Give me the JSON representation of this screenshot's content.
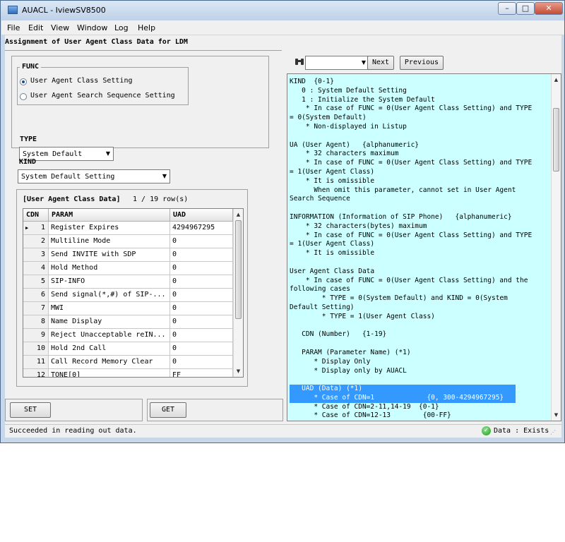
{
  "window": {
    "title": "AUACL - IviewSV8500"
  },
  "caption_buttons": {
    "minimize": "–",
    "maximize": "□",
    "close": "✕"
  },
  "menu": [
    "File",
    "Edit",
    "View",
    "Window",
    "Log",
    "Help"
  ],
  "form": {
    "title": "Assignment of User Agent Class Data for LDM",
    "func": {
      "legend": "FUNC",
      "options": [
        "User Agent Class Setting",
        "User Agent Search Sequence Setting"
      ],
      "selected": "User Agent Class Setting"
    },
    "type": {
      "label": "TYPE",
      "value": "System Default"
    },
    "kind": {
      "label": "KIND",
      "value": "System Default Setting"
    },
    "grid": {
      "title": "[User Agent Class Data]",
      "count": "1 / 19 row(s)",
      "columns": [
        "CDN",
        "PARAM",
        "UAD"
      ],
      "rows": [
        {
          "cdn": "1",
          "param": "Register Expires",
          "uad": "4294967295"
        },
        {
          "cdn": "2",
          "param": "Multiline Mode",
          "uad": "0"
        },
        {
          "cdn": "3",
          "param": "Send INVITE with SDP",
          "uad": "0"
        },
        {
          "cdn": "4",
          "param": "Hold Method",
          "uad": "0"
        },
        {
          "cdn": "5",
          "param": "SIP-INFO",
          "uad": "0"
        },
        {
          "cdn": "6",
          "param": "Send signal(*,#) of SIP-...",
          "uad": "0"
        },
        {
          "cdn": "7",
          "param": "MWI",
          "uad": "0"
        },
        {
          "cdn": "8",
          "param": "Name Display",
          "uad": "0"
        },
        {
          "cdn": "9",
          "param": "Reject Unacceptable reIN...",
          "uad": "0"
        },
        {
          "cdn": "10",
          "param": "Hold 2nd Call",
          "uad": "0"
        },
        {
          "cdn": "11",
          "param": "Call Record Memory Clear",
          "uad": "0"
        },
        {
          "cdn": "12",
          "param": "TONE[0]",
          "uad": "FF"
        }
      ]
    },
    "set_label": "SET",
    "get_label": "GET"
  },
  "search": {
    "next_label": "Next",
    "previous_label": "Previous",
    "value": ""
  },
  "help": {
    "lines": [
      "KIND  {0-1}",
      "   0 : System Default Setting",
      "   1 : Initialize the System Default",
      "    * In case of FUNC = 0(User Agent Class Setting) and TYPE",
      "= 0(System Default)",
      "    * Non-displayed in Listup",
      "",
      "UA (User Agent)   {alphanumeric}",
      "    * 32 characters maximum",
      "    * In case of FUNC = 0(User Agent Class Setting) and TYPE",
      "= 1(User Agent Class)",
      "    * It is omissible",
      "      When omit this parameter, cannot set in User Agent",
      "Search Sequence",
      "",
      "INFORMATION (Information of SIP Phone)   {alphanumeric}",
      "    * 32 characters(bytes) maximum",
      "    * In case of FUNC = 0(User Agent Class Setting) and TYPE",
      "= 1(User Agent Class)",
      "    * It is omissible",
      "",
      "User Agent Class Data",
      "    * In case of FUNC = 0(User Agent Class Setting) and the",
      "following cases",
      "        * TYPE = 0(System Default) and KIND = 0(System",
      "Default Setting)",
      "        * TYPE = 1(User Agent Class)",
      "",
      "   CDN (Number)   {1-19}",
      "",
      "   PARAM (Parameter Name) (*1)",
      "      * Display Only",
      "      * Display only by AUACL",
      "",
      "   UAD (Data) (*1)",
      "      * Case of CDN=1             {0, 300-4294967295}",
      "      * Case of CDN=2-11,14-19  {0-1}",
      "      * Case of CDN=12-13        {00-FF}"
    ]
  },
  "status": {
    "message": "Succeeded in reading out data.",
    "right": "Data : Exists"
  },
  "colors": {
    "help_bg": "#ccffff",
    "highlight": "#3399ff",
    "accent": "#1a4d8a"
  }
}
